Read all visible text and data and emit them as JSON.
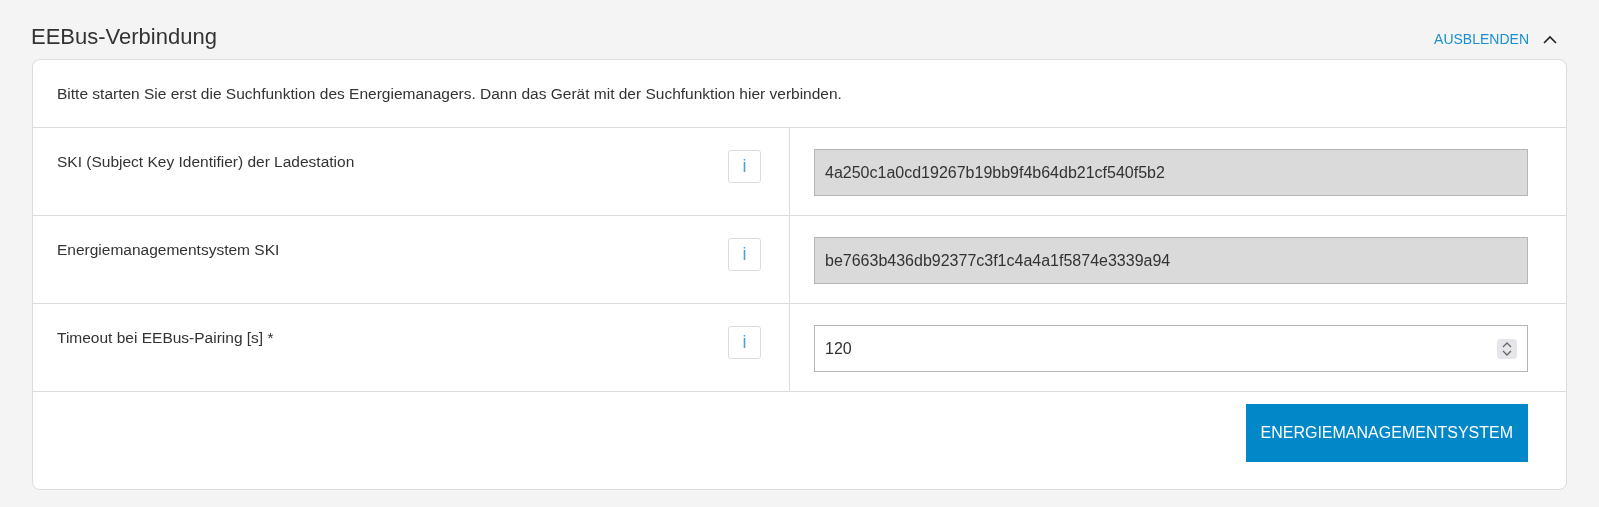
{
  "section": {
    "title": "EEBus-Verbindung",
    "toggle_label": "AUSBLENDEN",
    "expanded": true
  },
  "intro": "Bitte starten Sie erst die Suchfunktion des Energiemanagers. Dann das Gerät mit der Suchfunktion hier verbinden.",
  "rows": [
    {
      "label": "SKI (Subject Key Identifier) der Ladestation",
      "info": "i",
      "value": "4a250c1a0cd19267b19bb9f4b64db21cf540f5b2",
      "disabled": true,
      "kind": "text"
    },
    {
      "label": "Energiemanagementsystem SKI",
      "info": "i",
      "value": "be7663b436db92377c3f1c4a4a1f5874e3339a94",
      "disabled": true,
      "kind": "text"
    },
    {
      "label": "Timeout bei EEBus-Pairing [s] *",
      "info": "i",
      "value": "120",
      "disabled": false,
      "kind": "number"
    }
  ],
  "button": "ENERGIEMANAGEMENTSYSTEM"
}
